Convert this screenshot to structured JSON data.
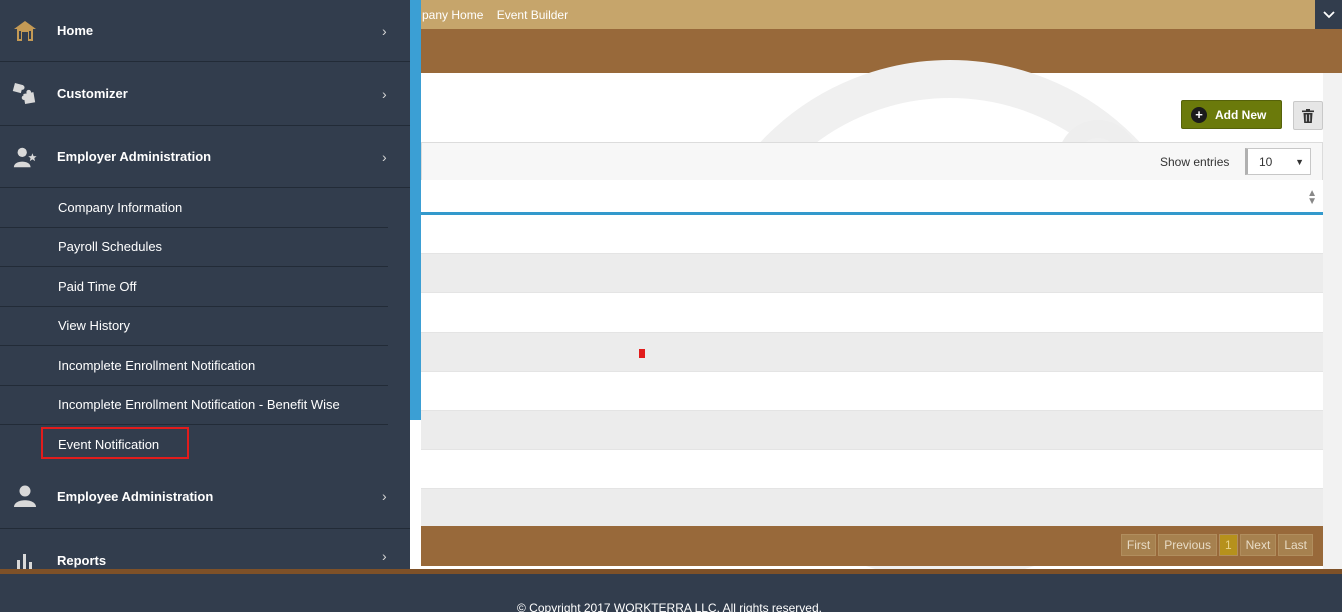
{
  "breadcrumb": [
    "pany Home",
    "Event Builder"
  ],
  "toolbar": {
    "add_new_label": "Add New"
  },
  "table": {
    "show_entries_label": "Show entries",
    "entries_value": "10",
    "pager": {
      "first": "First",
      "previous": "Previous",
      "current": "1",
      "next": "Next",
      "last": "Last"
    }
  },
  "sidebar": {
    "home": "Home",
    "customizer": "Customizer",
    "employer_admin": "Employer Administration",
    "employer_items": [
      "Company Information",
      "Payroll Schedules",
      "Paid Time Off",
      "View History",
      "Incomplete Enrollment Notification",
      "Incomplete Enrollment Notification - Benefit Wise",
      "Event Notification"
    ],
    "employee_admin": "Employee Administration",
    "reports": "Reports"
  },
  "footer": {
    "copyright": "© Copyright 2017 WORKTERRA LLC. All rights reserved."
  },
  "icons": {
    "home": "home-icon",
    "customizer": "puzzle-icon",
    "employer": "user-star-icon",
    "employee": "user-icon",
    "reports": "bar-chart-icon",
    "chevron": "chevron-right-icon",
    "add": "plus-circle-icon",
    "trash": "trash-icon"
  },
  "colors": {
    "sidebar_bg": "#323d4d",
    "brown": "#98693a",
    "tan": "#c6a56b",
    "accent_blue": "#3b9fd4",
    "add_button": "#6b7a0b",
    "highlight": "#e21c1c"
  }
}
